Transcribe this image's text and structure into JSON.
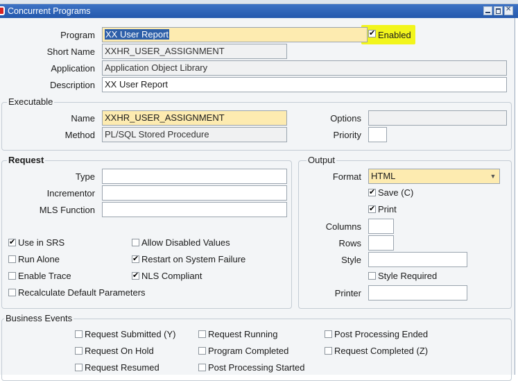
{
  "window": {
    "title": "Concurrent Programs"
  },
  "program": {
    "program_label": "Program",
    "program_value": "XX User Report",
    "enabled_label": "Enabled",
    "enabled_checked": true,
    "short_name_label": "Short Name",
    "short_name_value": "XXHR_USER_ASSIGNMENT",
    "application_label": "Application",
    "application_value": "Application Object Library",
    "description_label": "Description",
    "description_value": "XX User Report"
  },
  "executable": {
    "group_label": "Executable",
    "name_label": "Name",
    "name_value": "XXHR_USER_ASSIGNMENT",
    "method_label": "Method",
    "method_value": "PL/SQL Stored Procedure",
    "options_label": "Options",
    "options_value": "",
    "priority_label": "Priority",
    "priority_value": ""
  },
  "request": {
    "group_label": "Request",
    "type_label": "Type",
    "type_value": "",
    "incrementor_label": "Incrementor",
    "incrementor_value": "",
    "mls_label": "MLS Function",
    "mls_value": "",
    "checkboxes": {
      "use_in_srs": {
        "label": "Use in SRS",
        "checked": true
      },
      "allow_disabled": {
        "label": "Allow Disabled Values",
        "checked": false
      },
      "run_alone": {
        "label": "Run Alone",
        "checked": false
      },
      "restart": {
        "label": "Restart on System Failure",
        "checked": true
      },
      "enable_trace": {
        "label": "Enable Trace",
        "checked": false
      },
      "nls": {
        "label": "NLS Compliant",
        "checked": true
      },
      "recalc": {
        "label": "Recalculate Default Parameters",
        "checked": false
      }
    }
  },
  "output": {
    "group_label": "Output",
    "format_label": "Format",
    "format_value": "HTML",
    "save_label": "Save (C)",
    "save_checked": true,
    "print_label": "Print",
    "print_checked": true,
    "columns_label": "Columns",
    "columns_value": "",
    "rows_label": "Rows",
    "rows_value": "",
    "style_label": "Style",
    "style_value": "",
    "style_required_label": "Style Required",
    "style_required_checked": false,
    "printer_label": "Printer",
    "printer_value": ""
  },
  "business_events": {
    "group_label": "Business Events",
    "items": [
      {
        "label": "Request Submitted (Y)",
        "checked": false
      },
      {
        "label": "Request Running",
        "checked": false
      },
      {
        "label": "Post Processing Ended",
        "checked": false
      },
      {
        "label": "Request On Hold",
        "checked": false
      },
      {
        "label": "Program Completed",
        "checked": false
      },
      {
        "label": "Request Completed (Z)",
        "checked": false
      },
      {
        "label": "Request Resumed",
        "checked": false
      },
      {
        "label": "Post Processing Started",
        "checked": false
      }
    ]
  },
  "colors": {
    "title_bar": "#2459ad",
    "required_field": "#fdebb0",
    "highlight": "#f2f51c",
    "selection": "#2d5fa9"
  }
}
